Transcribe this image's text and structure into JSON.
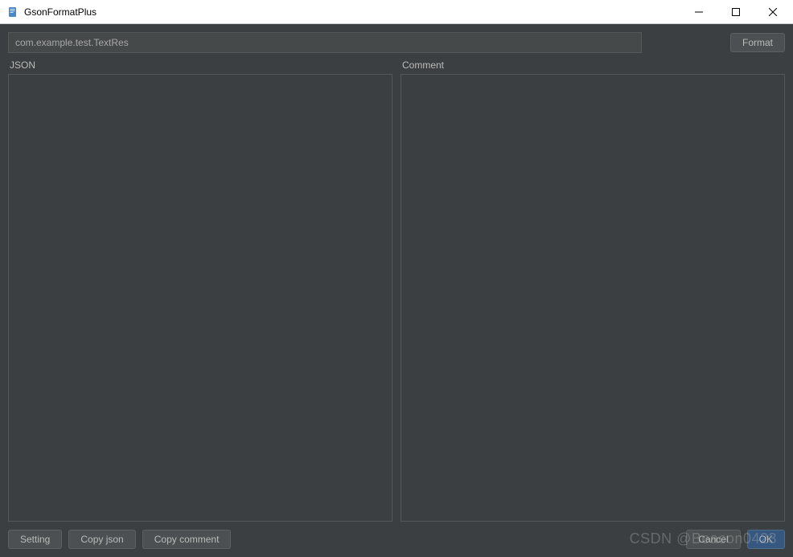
{
  "window": {
    "title": "GsonFormatPlus"
  },
  "header": {
    "class_path": "com.example.test.TextRes",
    "format_label": "Format"
  },
  "panels": {
    "json_label": "JSON",
    "comment_label": "Comment",
    "json_value": "",
    "comment_value": ""
  },
  "footer": {
    "setting_label": "Setting",
    "copy_json_label": "Copy  json",
    "copy_comment_label": "Copy comment",
    "cancel_label": "Cancel",
    "ok_label": "OK"
  },
  "watermark": "CSDN @Beacon0423"
}
